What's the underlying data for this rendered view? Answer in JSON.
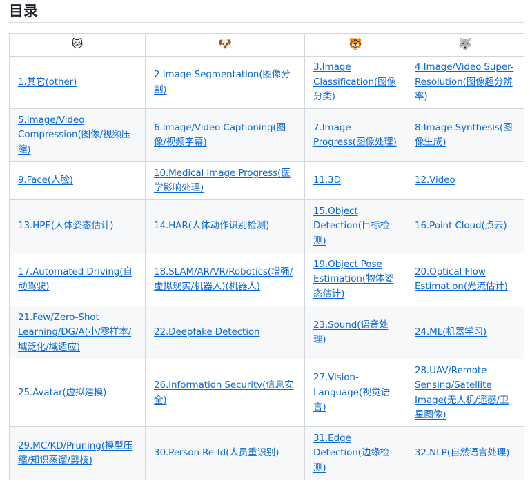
{
  "heading": "目录",
  "header_icons": [
    {
      "glyph": "🐱",
      "icon": "cat-face-icon"
    },
    {
      "glyph": "🐶",
      "icon": "dog-face-icon"
    },
    {
      "glyph": "🐯",
      "icon": "tiger-face-icon"
    },
    {
      "glyph": "🐺",
      "icon": "wolf-face-icon"
    }
  ],
  "rows": [
    [
      "1.其它(other)",
      "2.Image Segmentation(图像分割)",
      "3.Image Classification(图像分类)",
      "4.Image/Video Super-Resolution(图像超分辨率)"
    ],
    [
      "5.Image/Video Compression(图像/视频压缩)",
      "6.Image/Video Captioning(图像/视频字幕)",
      "7.Image Progress(图像处理)",
      "8.Image Synthesis(图像生成)"
    ],
    [
      "9.Face(人脸)",
      "10.Medical Image Progress(医学影响处理)",
      "11.3D",
      "12.Video"
    ],
    [
      "13.HPE(人体姿态估计)",
      "14.HAR(人体动作识别检测)",
      "15.Object Detection(目标检测)",
      "16.Point Cloud(点云)"
    ],
    [
      "17.Automated Driving(自动驾驶)",
      "18.SLAM/AR/VR/Robotics(增强/虚拟现实/机器人)(机器人)",
      "19.Object Pose Estimation(物体姿态估计)",
      "20.Optical Flow Estimation(光流估计)"
    ],
    [
      "21.Few/Zero-Shot Learning/DG/A(小/零样本/域泛化/域适应)",
      "22.Deepfake Detection",
      "23.Sound(语音处理)",
      "24.ML(机器学习)"
    ],
    [
      "25.Avatar(虚拟建模)",
      "26.Information Security(信息安全)",
      "27.Vision-Language(视觉语言)",
      "28.UAV/Remote Sensing/Satellite Image(无人机/遥感/卫星图像)"
    ],
    [
      "29.MC/KD/Pruning(模型压缩/知识蒸馏/剪枝)",
      "30.Person Re-Id(人员重识别)",
      "31.Edge Detection(边缘检测)",
      "32.NLP(自然语言处理)"
    ]
  ]
}
